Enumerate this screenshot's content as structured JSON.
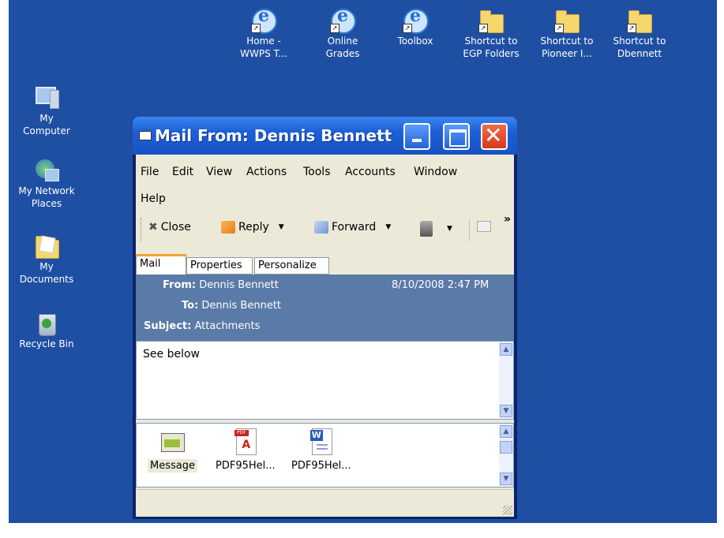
{
  "desktop_left": [
    {
      "label_lines": [
        "My",
        "Computer"
      ],
      "icon": "computer-icon"
    },
    {
      "label_lines": [
        "My Network",
        "Places"
      ],
      "icon": "network-icon"
    },
    {
      "label_lines": [
        "My",
        "Documents"
      ],
      "icon": "documents-icon"
    },
    {
      "label_lines": [
        "Recycle Bin"
      ],
      "icon": "recycle-bin-icon"
    }
  ],
  "desktop_top": [
    {
      "label_lines": [
        "Home -",
        "WWPS T..."
      ],
      "icon": "ie-shortcut-icon"
    },
    {
      "label_lines": [
        "Online",
        "Grades"
      ],
      "icon": "ie-shortcut-icon"
    },
    {
      "label_lines": [
        "Toolbox"
      ],
      "icon": "ie-shortcut-icon"
    },
    {
      "label_lines": [
        "Shortcut to",
        "EGP Folders"
      ],
      "icon": "folder-shortcut-icon"
    },
    {
      "label_lines": [
        "Shortcut to",
        "Pioneer I..."
      ],
      "icon": "folder-shortcut-icon"
    },
    {
      "label_lines": [
        "Shortcut to",
        "Dbennett"
      ],
      "icon": "folder-shortcut-icon"
    }
  ],
  "window": {
    "title": "Mail From: Dennis Bennett",
    "menu": [
      "File",
      "Edit",
      "View",
      "Actions",
      "Tools",
      "Accounts",
      "Window",
      "Help"
    ],
    "toolbar": {
      "close": "Close",
      "reply": "Reply",
      "forward": "Forward",
      "overflow": "»"
    },
    "tabs": [
      "Mail",
      "Properties",
      "Personalize"
    ],
    "header": {
      "from_label": "From:",
      "from": "Dennis Bennett",
      "date": "8/10/2008 2:47 PM",
      "to_label": "To:",
      "to": "Dennis Bennett",
      "subject_label": "Subject:",
      "subject": "Attachments"
    },
    "body": "See below",
    "attachments": [
      {
        "label": "Message",
        "icon": "message-icon"
      },
      {
        "label": "PDF95Hel...",
        "icon": "pdf-icon"
      },
      {
        "label": "PDF95Hel...",
        "icon": "word-doc-icon"
      }
    ]
  },
  "colors": {
    "desktop": "#1f4fa3",
    "titlebar": "#1c5fd6",
    "header": "#5a7aa8",
    "close_button": "#d33a1a"
  }
}
